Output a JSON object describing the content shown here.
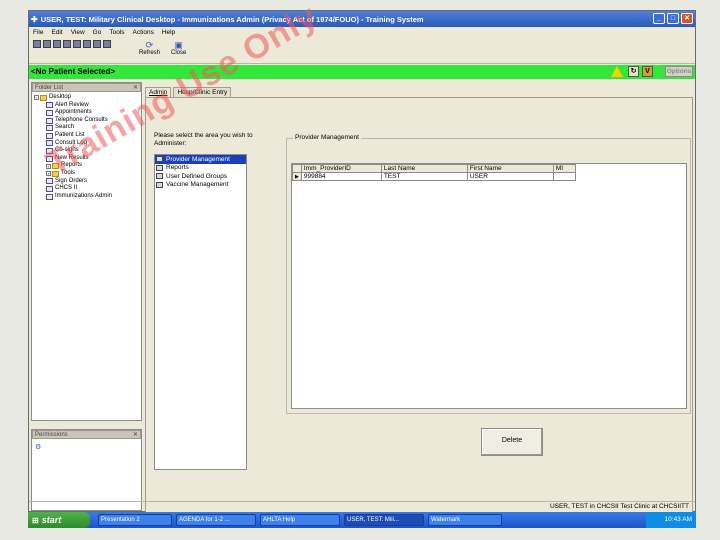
{
  "window": {
    "title": "USER, TEST: Military Clinical Desktop - Immunizations Admin (Privacy Act of 1974/FOUO) - Training System"
  },
  "menu": [
    "File",
    "Edit",
    "View",
    "Go",
    "Tools",
    "Actions",
    "Help"
  ],
  "toolbar": {
    "refresh_label": "Refresh",
    "close_label": "Close"
  },
  "patient_bar": {
    "text": "<No Patient Selected>",
    "options_label": "Options"
  },
  "folder_list": {
    "header": "Folder List",
    "items": [
      {
        "label": "Desktop",
        "icon": "folder-icon"
      },
      {
        "label": "Alert Review",
        "icon": "doc-icon"
      },
      {
        "label": "Appointments",
        "icon": "doc-icon"
      },
      {
        "label": "Telephone Consults",
        "icon": "doc-icon"
      },
      {
        "label": "Search",
        "icon": "doc-icon"
      },
      {
        "label": "Patient List",
        "icon": "doc-icon"
      },
      {
        "label": "Consult Log",
        "icon": "doc-icon"
      },
      {
        "label": "Co-signs",
        "icon": "doc-icon"
      },
      {
        "label": "New Results",
        "icon": "doc-icon"
      },
      {
        "label": "Reports",
        "icon": "folder-icon"
      },
      {
        "label": "Tools",
        "icon": "folder-icon"
      },
      {
        "label": "Sign Orders",
        "icon": "doc-icon"
      },
      {
        "label": "CHCS II",
        "icon": "doc-icon"
      },
      {
        "label": "Immunizations Admin",
        "icon": "doc-icon"
      }
    ]
  },
  "permissions": {
    "header": "Permissions"
  },
  "tabs": [
    "Admin",
    "Hosp/Clinic Entry"
  ],
  "admin": {
    "prompt": "Please select the area you wish to Administer:",
    "items": [
      "Provider Management",
      "Reports",
      "User Defined Groups",
      "Vaccine Management"
    ],
    "selected_index": 0
  },
  "provider_management": {
    "title": "Provider Management",
    "columns": [
      "Imm_ProviderID",
      "Last Name",
      "First Name",
      "MI"
    ],
    "rows": [
      [
        "999884",
        "TEST",
        "USER",
        ""
      ]
    ],
    "delete_label": "Delete"
  },
  "status_bar": {
    "text": "USER, TEST in CHCSII Test Clinic at CHCSIITT"
  },
  "watermark": "Training Use Only",
  "taskbar": {
    "start_label": "start",
    "tasks": [
      "Presentation 2",
      "AGENDA for 1-2 ...",
      "AHLTA Help",
      "USER, TEST: Mili...",
      "Watermark"
    ],
    "clock": "10:43 AM"
  }
}
